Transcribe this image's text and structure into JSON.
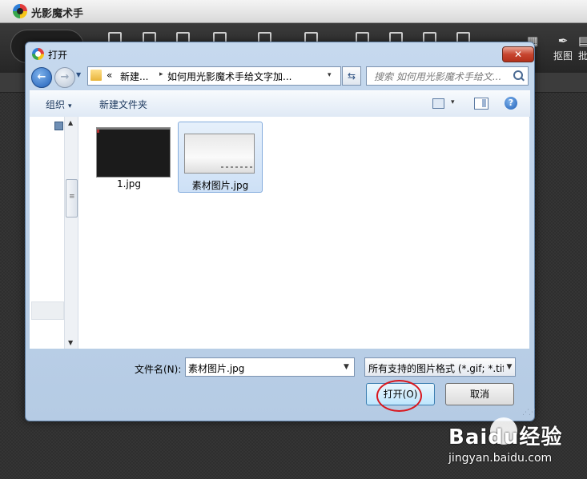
{
  "app": {
    "title": "光影魔术手",
    "toolbar_labels": [
      "抠图",
      "批"
    ]
  },
  "dialog": {
    "title": "打开",
    "close_glyph": "✕",
    "address": {
      "overflow": "«",
      "crumb_1": "新建...",
      "sep": "▸",
      "crumb_2": "如何用光影魔术手给文字加...",
      "dropdown": "▾"
    },
    "search_placeholder": "搜索 如何用光影魔术手给文...",
    "commands": {
      "organize": "组织",
      "organize_arrow": "▾",
      "new_folder": "新建文件夹",
      "view_arrow": "▾",
      "help": "?"
    },
    "files": [
      {
        "name": "1.jpg",
        "selected": false
      },
      {
        "name": "素材图片.jpg",
        "selected": true
      }
    ],
    "filename_label": "文件名(N):",
    "filename_value": "素材图片.jpg",
    "filetype_value": "所有支持的图片格式 (*.gif; *.tif",
    "open_button": "打开(O)",
    "cancel_button": "取消"
  },
  "watermark": {
    "brand": "Baidu经验",
    "url": "jingyan.baidu.com"
  }
}
